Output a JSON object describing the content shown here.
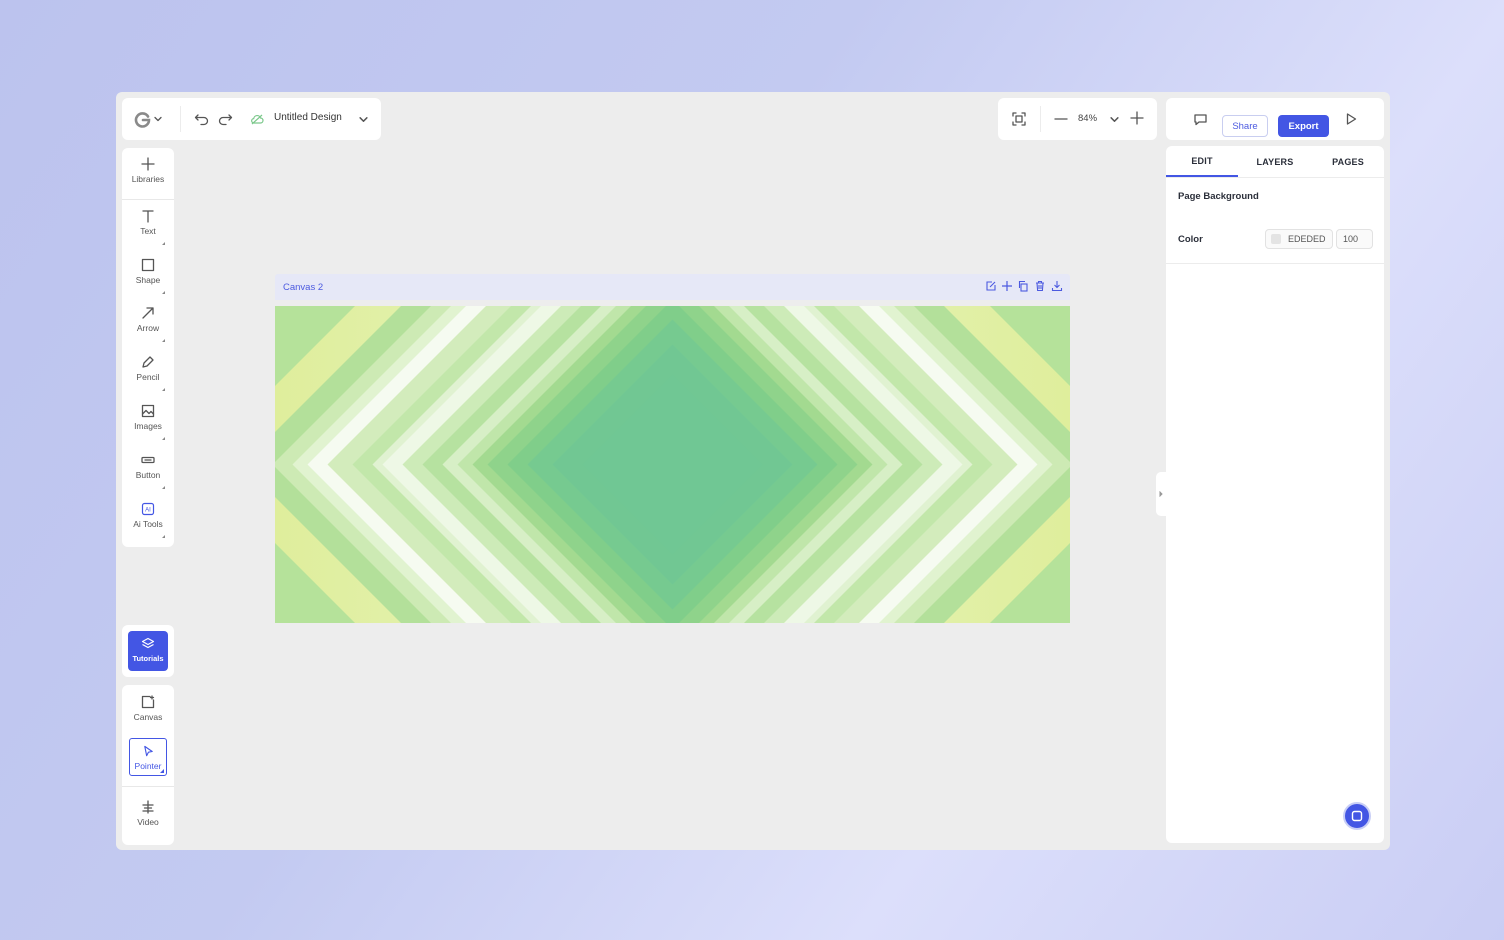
{
  "header": {
    "design_name": "Untitled Design",
    "zoom": "84%",
    "share_label": "Share",
    "export_label": "Export"
  },
  "toolbar": {
    "tools": [
      {
        "label": "Libraries",
        "icon": "plus-icon"
      },
      {
        "label": "Text",
        "icon": "text-icon"
      },
      {
        "label": "Shape",
        "icon": "square-icon"
      },
      {
        "label": "Arrow",
        "icon": "arrow-icon"
      },
      {
        "label": "Pencil",
        "icon": "pencil-icon"
      },
      {
        "label": "Images",
        "icon": "image-icon"
      },
      {
        "label": "Button",
        "icon": "button-icon"
      },
      {
        "label": "Ai Tools",
        "icon": "ai-icon"
      }
    ],
    "tutorials_label": "Tutorials",
    "canvas_label": "Canvas",
    "pointer_label": "Pointer",
    "video_label": "Video"
  },
  "canvas": {
    "name": "Canvas 2"
  },
  "right_panel": {
    "tabs": [
      "EDIT",
      "LAYERS",
      "PAGES"
    ],
    "section_title": "Page Background",
    "color_label": "Color",
    "color_hex": "EDEDED",
    "opacity": "100"
  },
  "colors": {
    "accent": "#4356e4",
    "app_bg": "#ededed",
    "art_center": "#70c794",
    "art_edge": "#dfee9c"
  }
}
